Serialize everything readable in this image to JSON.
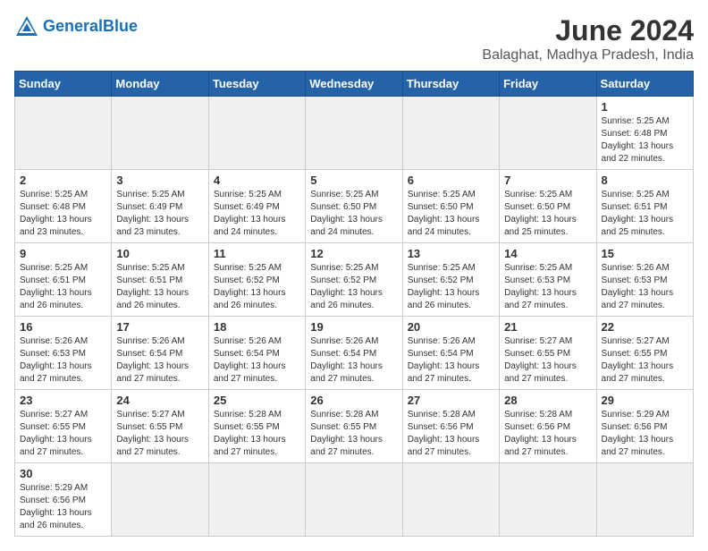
{
  "header": {
    "logo_general": "General",
    "logo_blue": "Blue",
    "title": "June 2024",
    "subtitle": "Balaghat, Madhya Pradesh, India"
  },
  "weekdays": [
    "Sunday",
    "Monday",
    "Tuesday",
    "Wednesday",
    "Thursday",
    "Friday",
    "Saturday"
  ],
  "weeks": [
    [
      {
        "day": "",
        "empty": true
      },
      {
        "day": "",
        "empty": true
      },
      {
        "day": "",
        "empty": true
      },
      {
        "day": "",
        "empty": true
      },
      {
        "day": "",
        "empty": true
      },
      {
        "day": "",
        "empty": true
      },
      {
        "day": "1",
        "sunrise": "Sunrise: 5:25 AM",
        "sunset": "Sunset: 6:48 PM",
        "daylight": "Daylight: 13 hours and 22 minutes."
      }
    ],
    [
      {
        "day": "2",
        "sunrise": "Sunrise: 5:25 AM",
        "sunset": "Sunset: 6:48 PM",
        "daylight": "Daylight: 13 hours and 23 minutes."
      },
      {
        "day": "3",
        "sunrise": "Sunrise: 5:25 AM",
        "sunset": "Sunset: 6:49 PM",
        "daylight": "Daylight: 13 hours and 23 minutes."
      },
      {
        "day": "4",
        "sunrise": "Sunrise: 5:25 AM",
        "sunset": "Sunset: 6:49 PM",
        "daylight": "Daylight: 13 hours and 24 minutes."
      },
      {
        "day": "5",
        "sunrise": "Sunrise: 5:25 AM",
        "sunset": "Sunset: 6:50 PM",
        "daylight": "Daylight: 13 hours and 24 minutes."
      },
      {
        "day": "6",
        "sunrise": "Sunrise: 5:25 AM",
        "sunset": "Sunset: 6:50 PM",
        "daylight": "Daylight: 13 hours and 24 minutes."
      },
      {
        "day": "7",
        "sunrise": "Sunrise: 5:25 AM",
        "sunset": "Sunset: 6:50 PM",
        "daylight": "Daylight: 13 hours and 25 minutes."
      },
      {
        "day": "8",
        "sunrise": "Sunrise: 5:25 AM",
        "sunset": "Sunset: 6:51 PM",
        "daylight": "Daylight: 13 hours and 25 minutes."
      }
    ],
    [
      {
        "day": "9",
        "sunrise": "Sunrise: 5:25 AM",
        "sunset": "Sunset: 6:51 PM",
        "daylight": "Daylight: 13 hours and 26 minutes."
      },
      {
        "day": "10",
        "sunrise": "Sunrise: 5:25 AM",
        "sunset": "Sunset: 6:51 PM",
        "daylight": "Daylight: 13 hours and 26 minutes."
      },
      {
        "day": "11",
        "sunrise": "Sunrise: 5:25 AM",
        "sunset": "Sunset: 6:52 PM",
        "daylight": "Daylight: 13 hours and 26 minutes."
      },
      {
        "day": "12",
        "sunrise": "Sunrise: 5:25 AM",
        "sunset": "Sunset: 6:52 PM",
        "daylight": "Daylight: 13 hours and 26 minutes."
      },
      {
        "day": "13",
        "sunrise": "Sunrise: 5:25 AM",
        "sunset": "Sunset: 6:52 PM",
        "daylight": "Daylight: 13 hours and 26 minutes."
      },
      {
        "day": "14",
        "sunrise": "Sunrise: 5:25 AM",
        "sunset": "Sunset: 6:53 PM",
        "daylight": "Daylight: 13 hours and 27 minutes."
      },
      {
        "day": "15",
        "sunrise": "Sunrise: 5:26 AM",
        "sunset": "Sunset: 6:53 PM",
        "daylight": "Daylight: 13 hours and 27 minutes."
      }
    ],
    [
      {
        "day": "16",
        "sunrise": "Sunrise: 5:26 AM",
        "sunset": "Sunset: 6:53 PM",
        "daylight": "Daylight: 13 hours and 27 minutes."
      },
      {
        "day": "17",
        "sunrise": "Sunrise: 5:26 AM",
        "sunset": "Sunset: 6:54 PM",
        "daylight": "Daylight: 13 hours and 27 minutes."
      },
      {
        "day": "18",
        "sunrise": "Sunrise: 5:26 AM",
        "sunset": "Sunset: 6:54 PM",
        "daylight": "Daylight: 13 hours and 27 minutes."
      },
      {
        "day": "19",
        "sunrise": "Sunrise: 5:26 AM",
        "sunset": "Sunset: 6:54 PM",
        "daylight": "Daylight: 13 hours and 27 minutes."
      },
      {
        "day": "20",
        "sunrise": "Sunrise: 5:26 AM",
        "sunset": "Sunset: 6:54 PM",
        "daylight": "Daylight: 13 hours and 27 minutes."
      },
      {
        "day": "21",
        "sunrise": "Sunrise: 5:27 AM",
        "sunset": "Sunset: 6:55 PM",
        "daylight": "Daylight: 13 hours and 27 minutes."
      },
      {
        "day": "22",
        "sunrise": "Sunrise: 5:27 AM",
        "sunset": "Sunset: 6:55 PM",
        "daylight": "Daylight: 13 hours and 27 minutes."
      }
    ],
    [
      {
        "day": "23",
        "sunrise": "Sunrise: 5:27 AM",
        "sunset": "Sunset: 6:55 PM",
        "daylight": "Daylight: 13 hours and 27 minutes."
      },
      {
        "day": "24",
        "sunrise": "Sunrise: 5:27 AM",
        "sunset": "Sunset: 6:55 PM",
        "daylight": "Daylight: 13 hours and 27 minutes."
      },
      {
        "day": "25",
        "sunrise": "Sunrise: 5:28 AM",
        "sunset": "Sunset: 6:55 PM",
        "daylight": "Daylight: 13 hours and 27 minutes."
      },
      {
        "day": "26",
        "sunrise": "Sunrise: 5:28 AM",
        "sunset": "Sunset: 6:55 PM",
        "daylight": "Daylight: 13 hours and 27 minutes."
      },
      {
        "day": "27",
        "sunrise": "Sunrise: 5:28 AM",
        "sunset": "Sunset: 6:56 PM",
        "daylight": "Daylight: 13 hours and 27 minutes."
      },
      {
        "day": "28",
        "sunrise": "Sunrise: 5:28 AM",
        "sunset": "Sunset: 6:56 PM",
        "daylight": "Daylight: 13 hours and 27 minutes."
      },
      {
        "day": "29",
        "sunrise": "Sunrise: 5:29 AM",
        "sunset": "Sunset: 6:56 PM",
        "daylight": "Daylight: 13 hours and 27 minutes."
      }
    ],
    [
      {
        "day": "30",
        "sunrise": "Sunrise: 5:29 AM",
        "sunset": "Sunset: 6:56 PM",
        "daylight": "Daylight: 13 hours and 26 minutes."
      },
      {
        "day": "",
        "empty": true
      },
      {
        "day": "",
        "empty": true
      },
      {
        "day": "",
        "empty": true
      },
      {
        "day": "",
        "empty": true
      },
      {
        "day": "",
        "empty": true
      },
      {
        "day": "",
        "empty": true
      }
    ]
  ]
}
